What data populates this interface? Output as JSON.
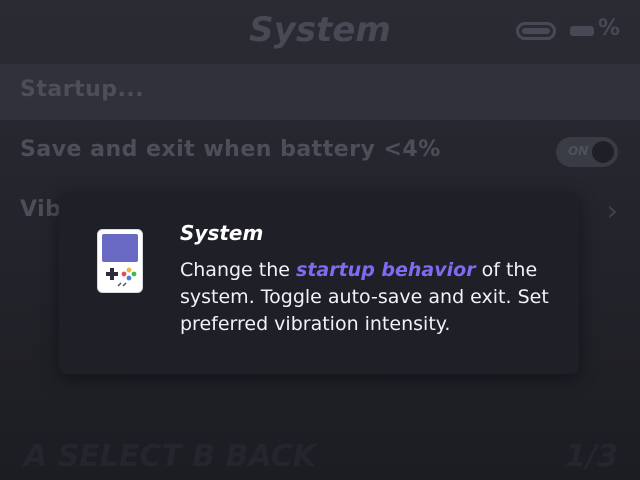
{
  "header": {
    "title": "System",
    "battery_suffix": "%"
  },
  "menu": {
    "items": [
      {
        "label": "Startup..."
      },
      {
        "label": "Save and exit when battery <4%",
        "toggle": "ON"
      },
      {
        "label": "Vib"
      }
    ]
  },
  "footer": {
    "hint": "A SELECT  B BACK",
    "page": "1/3"
  },
  "dialog": {
    "title": "System",
    "body_before": "Change the ",
    "body_highlight": "startup behavior",
    "body_after": " of the system. Toggle auto-save and exit. Set preferred vibration intensity.",
    "icon": "handheld-console-icon"
  },
  "colors": {
    "accent": "#7d6cf2",
    "dialog_bg": "#1f2027",
    "background": "#26272e"
  }
}
